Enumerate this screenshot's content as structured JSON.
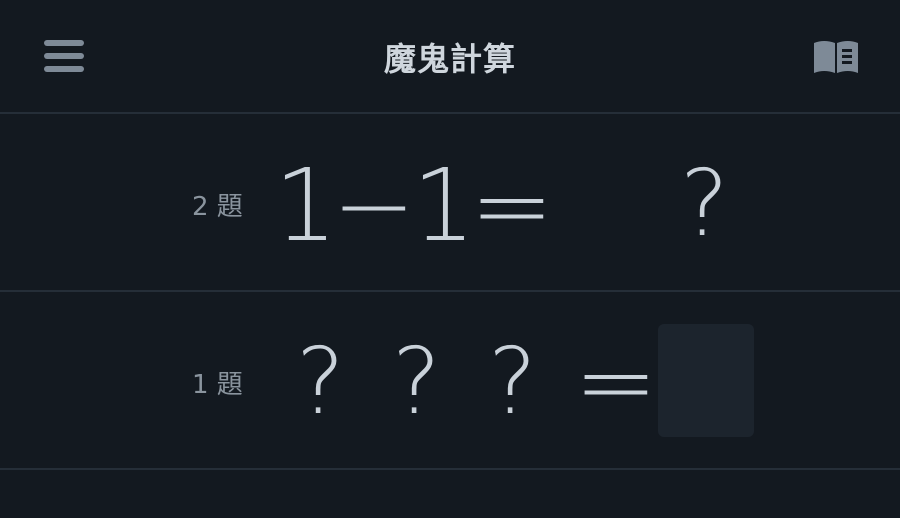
{
  "header": {
    "title": "魔鬼計算"
  },
  "questions": [
    {
      "number_label": "2 題",
      "left_operand": "1",
      "operator": "−",
      "right_operand": "1",
      "equals": "=",
      "answer": "?"
    },
    {
      "number_label": "1 題",
      "left_operand": "?",
      "operator": "?",
      "right_operand": "?",
      "equals": "=",
      "answer": ""
    }
  ],
  "icons": {
    "menu": "hamburger-menu-icon",
    "book": "open-book-icon"
  },
  "colors": {
    "background": "#131920",
    "divider": "#252e38",
    "text": "#c9d1d9",
    "muted": "#8a949e",
    "answer_box": "#1c242d"
  }
}
